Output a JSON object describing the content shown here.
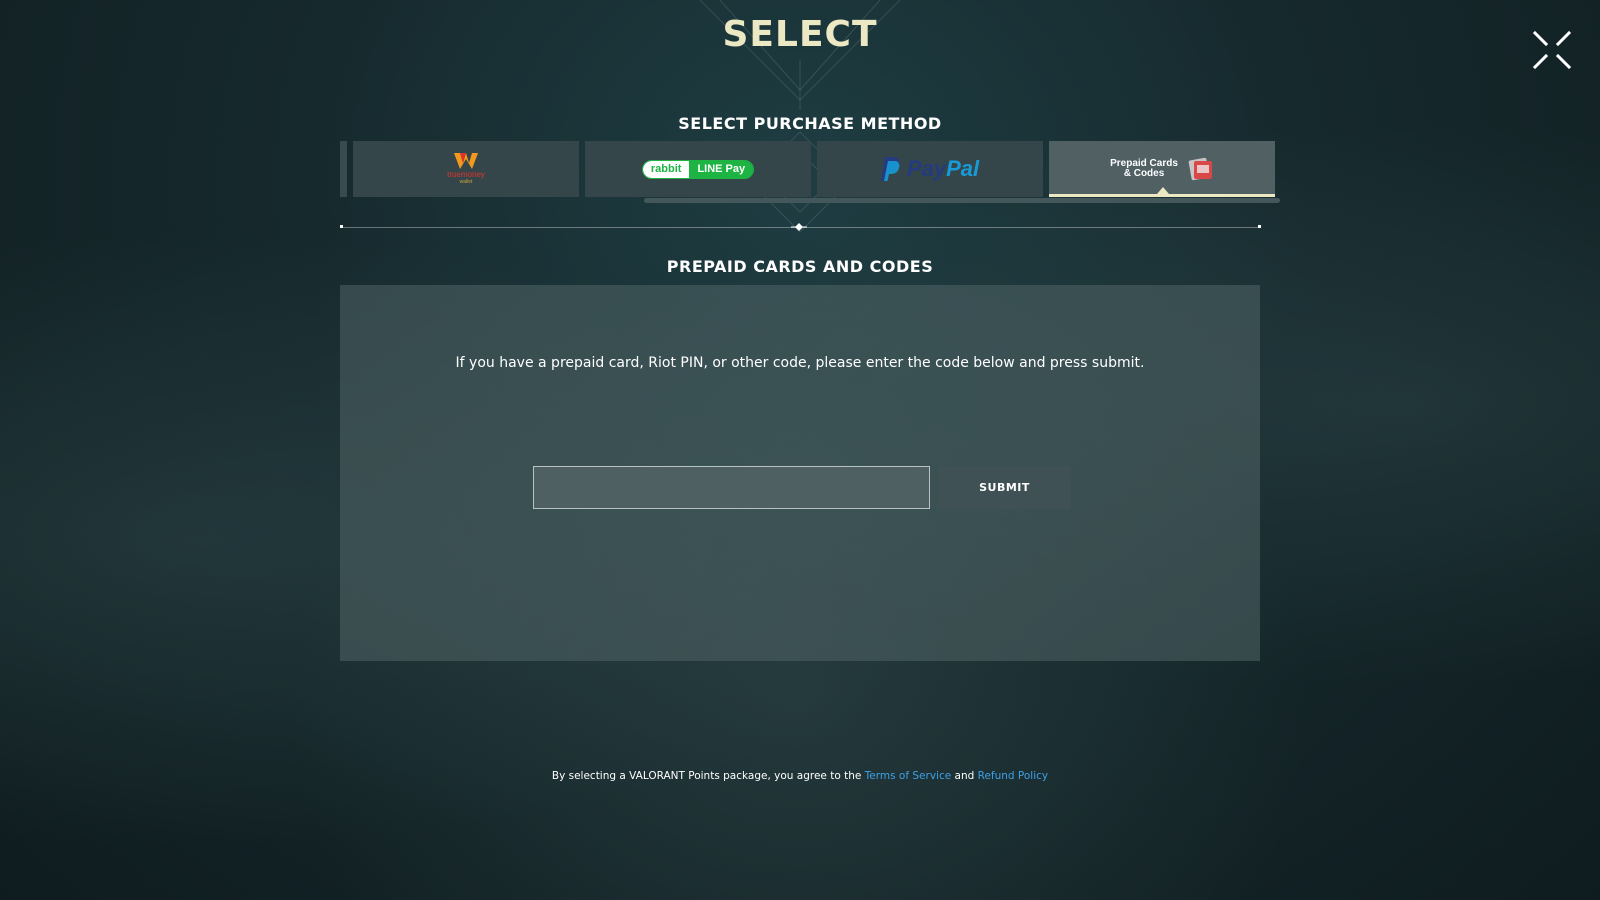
{
  "header": {
    "title": "SELECT"
  },
  "purchase_method": {
    "title": "SELECT PURCHASE METHOD",
    "methods": [
      {
        "id": "truemoney",
        "logo_text": "truemoney",
        "logo_sub": "wallet"
      },
      {
        "id": "rabbit-linepay",
        "logo_left": "rabbit",
        "logo_right": "LINE Pay"
      },
      {
        "id": "paypal",
        "logo_left": "Pay",
        "logo_right": "Pal"
      },
      {
        "id": "prepaid",
        "logo_line1": "Prepaid Cards",
        "logo_line2": "& Codes",
        "selected": true
      }
    ]
  },
  "prepaid": {
    "title": "PREPAID CARDS AND CODES",
    "instructions": "If you have a prepaid card, Riot PIN, or other code, please enter the code below and press submit.",
    "code_value": "",
    "submit_label": "SUBMIT"
  },
  "footer": {
    "prefix": "By selecting a VALORANT Points package, you agree to the ",
    "terms_link": "Terms of Service",
    "conjunction": " and ",
    "refund_link": "Refund Policy"
  },
  "colors": {
    "accent": "#ece8c3",
    "link": "#3fa0e6",
    "line_green": "#1db444",
    "paypal_dark": "#253b80",
    "paypal_light": "#179bd7"
  }
}
